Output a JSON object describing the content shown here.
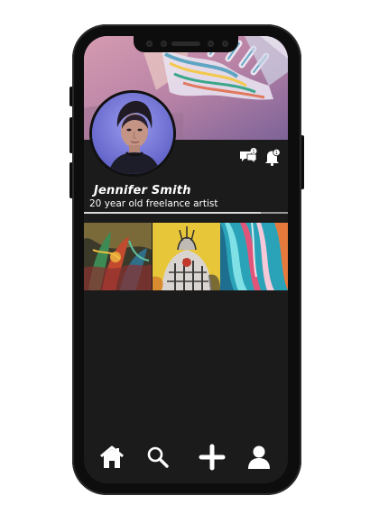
{
  "profile": {
    "name": "Jennifer Smith",
    "bio": "20 year old freelance artist"
  },
  "header_icons": [
    {
      "icon": "messages-icon"
    },
    {
      "icon": "notifications-icon"
    }
  ],
  "gallery": [
    {
      "icon": "artwork-thumbnail"
    },
    {
      "icon": "artwork-thumbnail"
    },
    {
      "icon": "artwork-thumbnail"
    }
  ],
  "bottom_nav": [
    {
      "icon": "home-icon"
    },
    {
      "icon": "search-icon"
    },
    {
      "icon": "add-icon"
    },
    {
      "icon": "profile-icon"
    }
  ],
  "colors": {
    "screen_background": "#1b1b1b",
    "text": "#ffffff",
    "frame": "#0d0d0d"
  }
}
